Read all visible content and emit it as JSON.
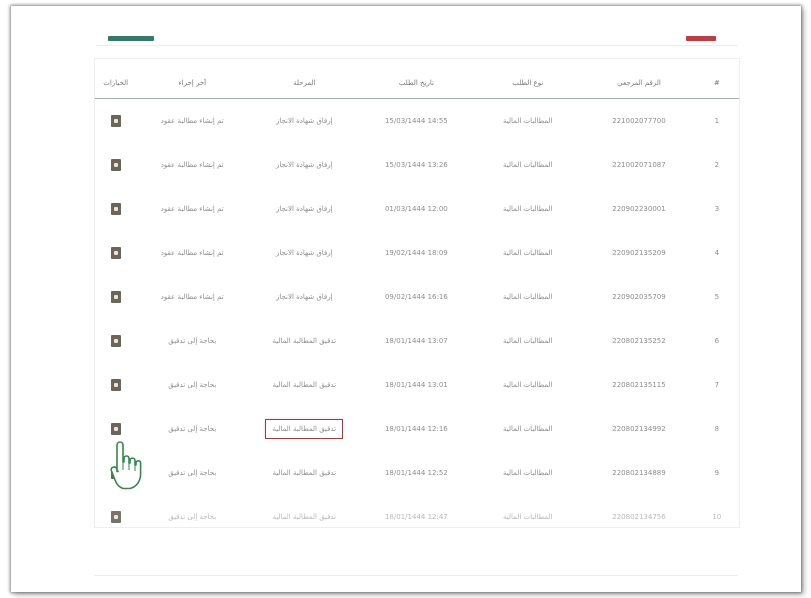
{
  "table": {
    "headers": {
      "num": "#",
      "ref": "الرقم المرجعي",
      "type": "نوع الطلب",
      "date": "تاريخ الطلب",
      "stage": "المرحلة",
      "action": "آخر إجراء",
      "options": "الخيارات"
    },
    "rows": [
      {
        "num": "1",
        "ref": "221002077700",
        "type": "المطالبات المالية",
        "date": "14:55 15/03/1444",
        "stage": "إرفاق شهادة الانجاز",
        "action": "تم إنشاء مطالبة عقود"
      },
      {
        "num": "2",
        "ref": "221002071087",
        "type": "المطالبات المالية",
        "date": "13:26 15/03/1444",
        "stage": "إرفاق شهادة الانجاز",
        "action": "تم إنشاء مطالبة عقود"
      },
      {
        "num": "3",
        "ref": "220902230001",
        "type": "المطالبات المالية",
        "date": "12:00 01/03/1444",
        "stage": "إرفاق شهادة الانجاز",
        "action": "تم إنشاء مطالبة عقود"
      },
      {
        "num": "4",
        "ref": "220902135209",
        "type": "المطالبات المالية",
        "date": "18:09 19/02/1444",
        "stage": "إرفاق شهادة الانجاز",
        "action": "تم إنشاء مطالبة عقود"
      },
      {
        "num": "5",
        "ref": "220902035709",
        "type": "المطالبات المالية",
        "date": "16:16 09/02/1444",
        "stage": "إرفاق شهادة الانجاز",
        "action": "تم إنشاء مطالبة عقود"
      },
      {
        "num": "6",
        "ref": "220802135252",
        "type": "المطالبات المالية",
        "date": "13:07 18/01/1444",
        "stage": "تدقيق المطالبة المالية",
        "action": "بحاجة إلى تدقيق"
      },
      {
        "num": "7",
        "ref": "220802135115",
        "type": "المطالبات المالية",
        "date": "13:01 18/01/1444",
        "stage": "تدقيق المطالبة المالية",
        "action": "بحاجة إلى تدقيق"
      },
      {
        "num": "8",
        "ref": "220802134992",
        "type": "المطالبات المالية",
        "date": "12:16 18/01/1444",
        "stage": "تدقيق المطالبة المالية",
        "action": "بحاجة إلى تدقيق"
      },
      {
        "num": "9",
        "ref": "220802134889",
        "type": "المطالبات المالية",
        "date": "12:52 18/01/1444",
        "stage": "تدقيق المطالبة المالية",
        "action": "بحاجة إلى تدقيق"
      },
      {
        "num": "10",
        "ref": "220802134756",
        "type": "المطالبات المالية",
        "date": "12:47 18/01/1444",
        "stage": "تدقيق المطالبة المالية",
        "action": "بحاجة إلى تدقيق"
      }
    ]
  },
  "colors": {
    "accent_green": "#2e7d6b",
    "accent_red": "#c8383e",
    "option_button": "#6b655a",
    "highlight_border": "#d8262f"
  },
  "icons": {
    "options": "options-icon",
    "cursor": "hand-pointer-icon"
  }
}
